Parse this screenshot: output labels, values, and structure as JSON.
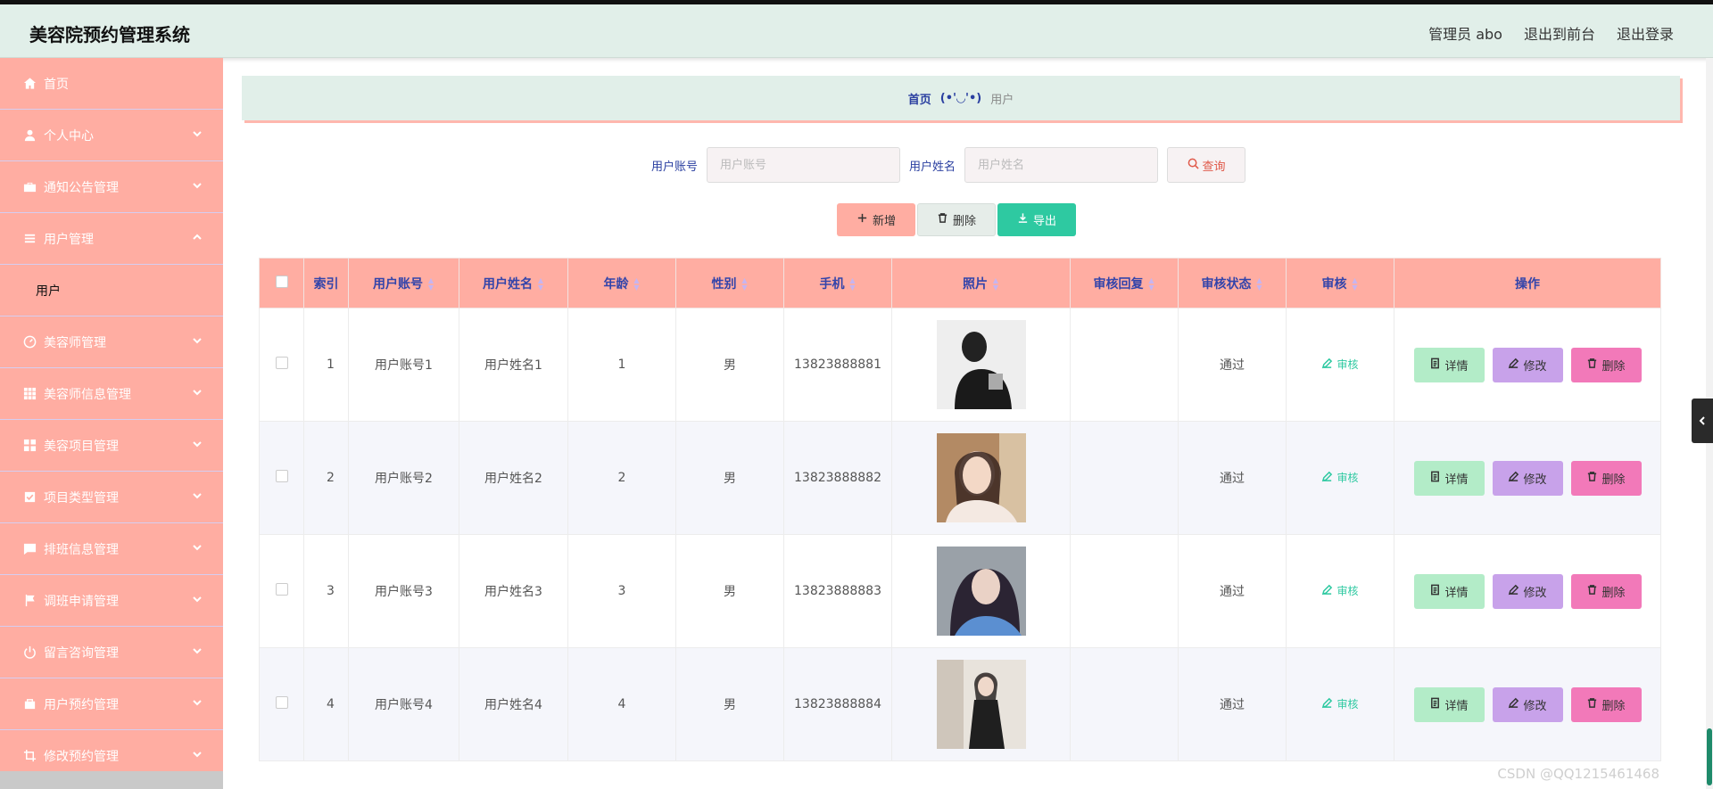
{
  "app": {
    "title": "美容院预约管理系统"
  },
  "top_links": {
    "admin": "管理员 abo",
    "front": "退出到前台",
    "logout": "退出登录"
  },
  "sidebar": {
    "items": [
      {
        "label": "首页",
        "icon": "home-icon"
      },
      {
        "label": "个人中心",
        "icon": "user-icon"
      },
      {
        "label": "通知公告管理",
        "icon": "briefcase-icon"
      },
      {
        "label": "用户管理",
        "icon": "list-icon",
        "expanded": true,
        "children": [
          "用户"
        ]
      },
      {
        "label": "美容师管理",
        "icon": "dashboard-icon"
      },
      {
        "label": "美容师信息管理",
        "icon": "grid-icon"
      },
      {
        "label": "美容项目管理",
        "icon": "apps-icon"
      },
      {
        "label": "项目类型管理",
        "icon": "check-box-icon"
      },
      {
        "label": "排班信息管理",
        "icon": "chat-icon"
      },
      {
        "label": "调班申请管理",
        "icon": "flag-icon"
      },
      {
        "label": "留言咨询管理",
        "icon": "power-icon"
      },
      {
        "label": "用户预约管理",
        "icon": "bag-icon"
      },
      {
        "label": "修改预约管理",
        "icon": "crop-icon"
      }
    ]
  },
  "breadcrumb": {
    "home": "首页",
    "separator": "(•'◡'•)",
    "current": "用户"
  },
  "search": {
    "account_label": "用户账号",
    "account_placeholder": "用户账号",
    "name_label": "用户姓名",
    "name_placeholder": "用户姓名",
    "query_button": "查询"
  },
  "actions": {
    "add": "新增",
    "delete": "删除",
    "export": "导出"
  },
  "table": {
    "columns": [
      "索引",
      "用户账号",
      "用户姓名",
      "年龄",
      "性别",
      "手机",
      "照片",
      "审核回复",
      "审核状态",
      "审核",
      "操作"
    ],
    "audit_link": "审核",
    "op_detail": "详情",
    "op_edit": "修改",
    "op_delete": "删除",
    "rows": [
      {
        "index": "1",
        "account": "用户账号1",
        "name": "用户姓名1",
        "age": "1",
        "gender": "男",
        "phone": "13823888881",
        "reply": "",
        "status": "通过"
      },
      {
        "index": "2",
        "account": "用户账号2",
        "name": "用户姓名2",
        "age": "2",
        "gender": "男",
        "phone": "13823888882",
        "reply": "",
        "status": "通过"
      },
      {
        "index": "3",
        "account": "用户账号3",
        "name": "用户姓名3",
        "age": "3",
        "gender": "男",
        "phone": "13823888883",
        "reply": "",
        "status": "通过"
      },
      {
        "index": "4",
        "account": "用户账号4",
        "name": "用户姓名4",
        "age": "4",
        "gender": "男",
        "phone": "13823888884",
        "reply": "",
        "status": "通过"
      }
    ]
  },
  "watermark": "CSDN @QQ1215461468",
  "colors": {
    "accent": "#ffada2",
    "header_bg": "#e1efe9",
    "export": "#2ec9a1",
    "link": "#3344aa"
  }
}
